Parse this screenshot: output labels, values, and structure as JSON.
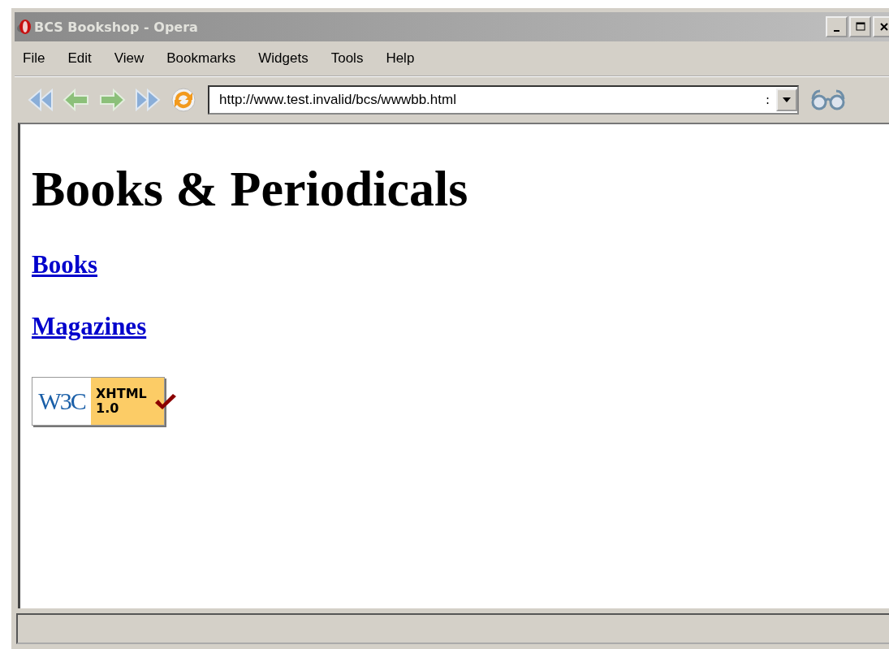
{
  "window": {
    "title": "BCS Bookshop - Opera"
  },
  "menu": [
    "File",
    "Edit",
    "View",
    "Bookmarks",
    "Widgets",
    "Tools",
    "Help"
  ],
  "address": {
    "value": "http://www.test.invalid/bcs/wwwbb.html",
    "suffix": ":"
  },
  "page": {
    "heading": "Books & Periodicals",
    "links": [
      "Books",
      "Magazines"
    ],
    "badge": {
      "logo": "W3C",
      "label": "XHTML",
      "version": "1.0"
    }
  }
}
